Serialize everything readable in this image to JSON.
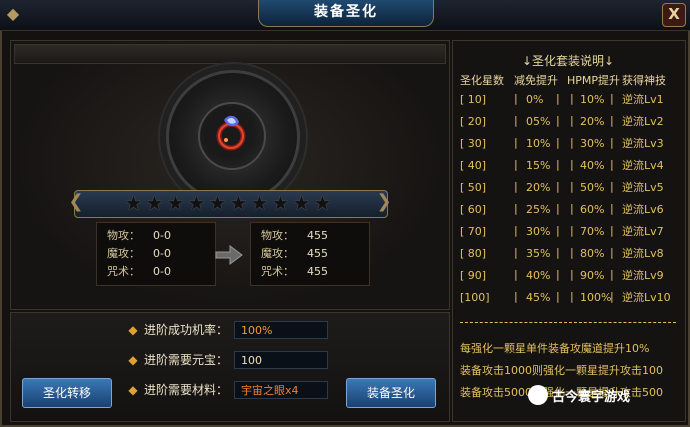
{
  "window": {
    "title": "装备圣化",
    "close_glyph": "X"
  },
  "equip_stats": {
    "current": [
      {
        "label": "物攻：",
        "value": "0-0"
      },
      {
        "label": "魔攻：",
        "value": "0-0"
      },
      {
        "label": "咒术：",
        "value": "0-0"
      }
    ],
    "next": [
      {
        "label": "物攻：",
        "value": "455"
      },
      {
        "label": "魔攻：",
        "value": "455"
      },
      {
        "label": "咒术：",
        "value": "455"
      }
    ],
    "stars_lit": 0,
    "stars_total": 10
  },
  "requirements": [
    {
      "label": "进阶成功机率：",
      "value": "100%",
      "color": "#f0a030"
    },
    {
      "label": "进阶需要元宝：",
      "value": "100",
      "color": "#f0e0b0"
    },
    {
      "label": "进阶需要材料：",
      "value": "宇宙之眼x4",
      "color": "#f08030"
    }
  ],
  "buttons": {
    "transfer": "圣化转移",
    "sanctify": "装备圣化"
  },
  "set_info": {
    "title": "↓圣化套装说明↓",
    "headers": [
      "圣化星数",
      "减免提升",
      "HPMP提升",
      "获得神技"
    ],
    "rows": [
      [
        "[ 10]",
        "0%",
        "10%",
        "逆流Lv1"
      ],
      [
        "[ 20]",
        "05%",
        "20%",
        "逆流Lv2"
      ],
      [
        "[ 30]",
        "10%",
        "30%",
        "逆流Lv3"
      ],
      [
        "[ 40]",
        "15%",
        "40%",
        "逆流Lv4"
      ],
      [
        "[ 50]",
        "20%",
        "50%",
        "逆流Lv5"
      ],
      [
        "[ 60]",
        "25%",
        "60%",
        "逆流Lv6"
      ],
      [
        "[ 70]",
        "30%",
        "70%",
        "逆流Lv7"
      ],
      [
        "[ 80]",
        "35%",
        "80%",
        "逆流Lv8"
      ],
      [
        "[ 90]",
        "40%",
        "90%",
        "逆流Lv9"
      ],
      [
        "[100]",
        "45%",
        "100%",
        "逆流Lv10"
      ]
    ],
    "notes": [
      "每强化一颗星单件装备攻魔道提升10%",
      "装备攻击1000则强化一颗星提升攻击100",
      "装备攻击5000则强化一颗星提升攻击500"
    ]
  },
  "watermark": "古今寰宇游戏"
}
